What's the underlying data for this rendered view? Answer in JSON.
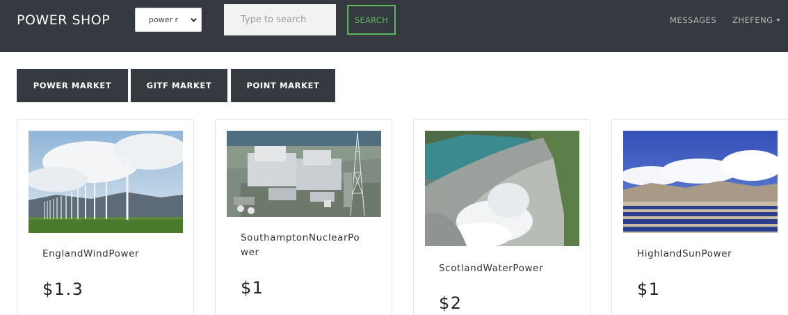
{
  "header": {
    "brand": "POWER SHOP",
    "filter_select_value": "power r",
    "search_placeholder": "Type to search",
    "search_label": "SEARCH",
    "messages_label": "MESSAGES",
    "user_label": "ZHEFENG"
  },
  "markets": [
    {
      "label": "POWER MARKET"
    },
    {
      "label": "GITF MARKET"
    },
    {
      "label": "POINT MARKET"
    }
  ],
  "products": [
    {
      "name": "EnglandWindPower",
      "price": "$1.3",
      "image": "wind-turbines-photo"
    },
    {
      "name": "SouthamptonNuclearPower",
      "price": "$1",
      "image": "nuclear-plant-photo"
    },
    {
      "name": "ScotlandWaterPower",
      "price": "$2",
      "image": "hydro-dam-photo"
    },
    {
      "name": "HighlandSunPower",
      "price": "$1",
      "image": "solar-farm-photo"
    }
  ],
  "colors": {
    "navbar": "#343a40",
    "search_accent": "#5cb85c",
    "nav_link": "#b5b8bb"
  }
}
